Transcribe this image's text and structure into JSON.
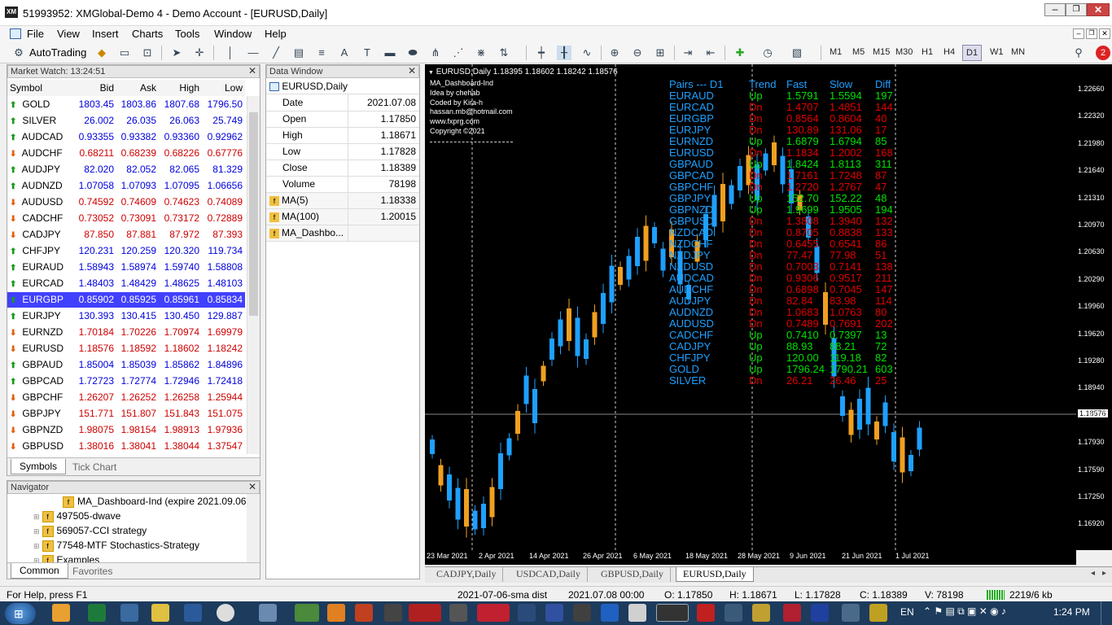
{
  "window": {
    "title": "51993952: XMGlobal-Demo 4 - Demo Account - [EURUSD,Daily]"
  },
  "menu": [
    "File",
    "View",
    "Insert",
    "Charts",
    "Tools",
    "Window",
    "Help"
  ],
  "toolbar": {
    "autotrading": "AutoTrading",
    "timeframes": [
      "M1",
      "M5",
      "M15",
      "M30",
      "H1",
      "H4",
      "D1",
      "W1",
      "MN"
    ],
    "active_tf": "D1",
    "badge": "2"
  },
  "market_watch": {
    "title": "Market Watch: 13:24:51",
    "headers": [
      "Symbol",
      "Bid",
      "Ask",
      "High",
      "Low"
    ],
    "rows": [
      {
        "s": "GOLD",
        "b": "1803.45",
        "a": "1803.86",
        "h": "1807.68",
        "l": "1796.50",
        "dir": "up"
      },
      {
        "s": "SILVER",
        "b": "26.002",
        "a": "26.035",
        "h": "26.063",
        "l": "25.749",
        "dir": "up"
      },
      {
        "s": "AUDCAD",
        "b": "0.93355",
        "a": "0.93382",
        "h": "0.93360",
        "l": "0.92962",
        "dir": "up"
      },
      {
        "s": "AUDCHF",
        "b": "0.68211",
        "a": "0.68239",
        "h": "0.68226",
        "l": "0.67776",
        "dir": "dn"
      },
      {
        "s": "AUDJPY",
        "b": "82.020",
        "a": "82.052",
        "h": "82.065",
        "l": "81.329",
        "dir": "up"
      },
      {
        "s": "AUDNZD",
        "b": "1.07058",
        "a": "1.07093",
        "h": "1.07095",
        "l": "1.06656",
        "dir": "up"
      },
      {
        "s": "AUDUSD",
        "b": "0.74592",
        "a": "0.74609",
        "h": "0.74623",
        "l": "0.74089",
        "dir": "dn"
      },
      {
        "s": "CADCHF",
        "b": "0.73052",
        "a": "0.73091",
        "h": "0.73172",
        "l": "0.72889",
        "dir": "dn"
      },
      {
        "s": "CADJPY",
        "b": "87.850",
        "a": "87.881",
        "h": "87.972",
        "l": "87.393",
        "dir": "dn"
      },
      {
        "s": "CHFJPY",
        "b": "120.231",
        "a": "120.259",
        "h": "120.320",
        "l": "119.734",
        "dir": "up"
      },
      {
        "s": "EURAUD",
        "b": "1.58943",
        "a": "1.58974",
        "h": "1.59740",
        "l": "1.58808",
        "dir": "up"
      },
      {
        "s": "EURCAD",
        "b": "1.48403",
        "a": "1.48429",
        "h": "1.48625",
        "l": "1.48103",
        "dir": "up"
      },
      {
        "s": "EURGBP",
        "b": "0.85902",
        "a": "0.85925",
        "h": "0.85961",
        "l": "0.85834",
        "dir": "up",
        "sel": true
      },
      {
        "s": "EURJPY",
        "b": "130.393",
        "a": "130.415",
        "h": "130.450",
        "l": "129.887",
        "dir": "up"
      },
      {
        "s": "EURNZD",
        "b": "1.70184",
        "a": "1.70226",
        "h": "1.70974",
        "l": "1.69979",
        "dir": "dn"
      },
      {
        "s": "EURUSD",
        "b": "1.18576",
        "a": "1.18592",
        "h": "1.18602",
        "l": "1.18242",
        "dir": "dn"
      },
      {
        "s": "GBPAUD",
        "b": "1.85004",
        "a": "1.85039",
        "h": "1.85862",
        "l": "1.84896",
        "dir": "up"
      },
      {
        "s": "GBPCAD",
        "b": "1.72723",
        "a": "1.72774",
        "h": "1.72946",
        "l": "1.72418",
        "dir": "up"
      },
      {
        "s": "GBPCHF",
        "b": "1.26207",
        "a": "1.26252",
        "h": "1.26258",
        "l": "1.25944",
        "dir": "dn"
      },
      {
        "s": "GBPJPY",
        "b": "151.771",
        "a": "151.807",
        "h": "151.843",
        "l": "151.075",
        "dir": "dn"
      },
      {
        "s": "GBPNZD",
        "b": "1.98075",
        "a": "1.98154",
        "h": "1.98913",
        "l": "1.97936",
        "dir": "dn"
      },
      {
        "s": "GBPUSD",
        "b": "1.38016",
        "a": "1.38041",
        "h": "1.38044",
        "l": "1.37547",
        "dir": "dn"
      }
    ],
    "tabs": [
      "Symbols",
      "Tick Chart"
    ]
  },
  "data_window": {
    "title": "Data Window",
    "symbol": "EURUSD,Daily",
    "rows": [
      [
        "Date",
        "2021.07.08"
      ],
      [
        "Open",
        "1.17850"
      ],
      [
        "High",
        "1.18671"
      ],
      [
        "Low",
        "1.17828"
      ],
      [
        "Close",
        "1.18389"
      ],
      [
        "Volume",
        "78198"
      ]
    ],
    "indicators": [
      [
        "MA(5)",
        "1.18338"
      ],
      [
        "MA(100)",
        "1.20015"
      ],
      [
        "MA_Dashbo...",
        ""
      ]
    ]
  },
  "navigator": {
    "title": "Navigator",
    "items": [
      "MA_Dashboard-Ind (expire 2021.09.06)",
      "497505-dwave",
      "569057-CCI strategy",
      "77548-MTF Stochastics-Strategy",
      "Examples"
    ],
    "tabs": [
      "Common",
      "Favorites"
    ]
  },
  "chart": {
    "header": "EURUSD,Daily  1.18395 1.18602 1.18242 1.18576",
    "info": [
      "MA_Dashboard-Ind",
      "Idea by chehab",
      "Coded by Kira-h",
      "hassan.mb@hotmail.com",
      "www.fxprg.com",
      "Copyright ©2021"
    ],
    "dash_headers": [
      "Pairs --- D1",
      "Trend",
      "Fast",
      "Slow",
      "Diff"
    ],
    "dash_rows": [
      [
        "EURAUD",
        "Up",
        "1.5791",
        "1.5594",
        "197"
      ],
      [
        "EURCAD",
        "Dn",
        "1.4707",
        "1.4851",
        "144"
      ],
      [
        "EURGBP",
        "Dn",
        "0.8564",
        "0.8604",
        "40"
      ],
      [
        "EURJPY",
        "Dn",
        "130.89",
        "131.06",
        "17"
      ],
      [
        "EURNZD",
        "Up",
        "1.6879",
        "1.6794",
        "85"
      ],
      [
        "EURUSD",
        "Dn",
        "1.1834",
        "1.2002",
        "168"
      ],
      [
        "GBPAUD",
        "Up",
        "1.8424",
        "1.8113",
        "311"
      ],
      [
        "GBPCAD",
        "Dn",
        "1.7161",
        "1.7248",
        "87"
      ],
      [
        "GBPCHF",
        "Dn",
        "1.2720",
        "1.2767",
        "47"
      ],
      [
        "GBPJPY",
        "Up",
        "152.70",
        "152.22",
        "48"
      ],
      [
        "GBPNZD",
        "Up",
        "1.9699",
        "1.9505",
        "194"
      ],
      [
        "GBPUSD",
        "Dn",
        "1.3808",
        "1.3940",
        "132"
      ],
      [
        "NZDCAD",
        "Dn",
        "0.8705",
        "0.8838",
        "133"
      ],
      [
        "NZDCHF",
        "Dn",
        "0.6455",
        "0.6541",
        "86"
      ],
      [
        "NZDJPY",
        "Dn",
        "77.47",
        "77.98",
        "51"
      ],
      [
        "NZDUSD",
        "Dn",
        "0.7003",
        "0.7141",
        "138"
      ],
      [
        "AUDCAD",
        "Dn",
        "0.9306",
        "0.9517",
        "211"
      ],
      [
        "AUDCHF",
        "Dn",
        "0.6898",
        "0.7045",
        "147"
      ],
      [
        "AUDJPY",
        "Dn",
        "82.84",
        "83.98",
        "114"
      ],
      [
        "AUDNZD",
        "Dn",
        "1.0683",
        "1.0763",
        "80"
      ],
      [
        "AUDUSD",
        "Dn",
        "0.7489",
        "0.7691",
        "202"
      ],
      [
        "CADCHF",
        "Up",
        "0.7410",
        "0.7397",
        "13"
      ],
      [
        "CADJPY",
        "Up",
        "88.93",
        "88.21",
        "72"
      ],
      [
        "CHFJPY",
        "Up",
        "120.00",
        "119.18",
        "82"
      ],
      [
        "GOLD",
        "Up",
        "1796.24",
        "1790.21",
        "603"
      ],
      [
        "SILVER",
        "Dn",
        "26.21",
        "26.46",
        "25"
      ]
    ],
    "dates": [
      "23 Mar 2021",
      "2 Apr 2021",
      "14 Apr 2021",
      "26 Apr 2021",
      "6 May 2021",
      "18 May 2021",
      "28 May 2021",
      "9 Jun 2021",
      "21 Jun 2021",
      "1 Jul 2021"
    ],
    "prices": [
      "1.22660",
      "1.22320",
      "1.21980",
      "1.21640",
      "1.21310",
      "1.20970",
      "1.20630",
      "1.20290",
      "1.19960",
      "1.19620",
      "1.19280",
      "1.18940",
      "1.18576",
      "1.18270",
      "1.17930",
      "1.17590",
      "1.17250",
      "1.16920"
    ],
    "current_price": "1.18576",
    "tabs": [
      "CADJPY,Daily",
      "USDCAD,Daily",
      "GBPUSD,Daily",
      "EURUSD,Daily"
    ],
    "active_tab": "EURUSD,Daily",
    "colors": {
      "bull": "#1ea0ff",
      "bear": "#f0a020",
      "up": "#00e000",
      "dn": "#e00000",
      "pair": "#1ea0ff"
    }
  },
  "status": {
    "help": "For Help, press F1",
    "profile": "2021-07-06-sma dist",
    "datetime": "2021.07.08 00:00",
    "o": "O: 1.17850",
    "h": "H: 1.18671",
    "l": "L: 1.17828",
    "c": "C: 1.18389",
    "v": "V: 78198",
    "traffic": "2219/6 kb"
  },
  "taskbar": {
    "lang": "EN",
    "time": "1:24 PM"
  }
}
